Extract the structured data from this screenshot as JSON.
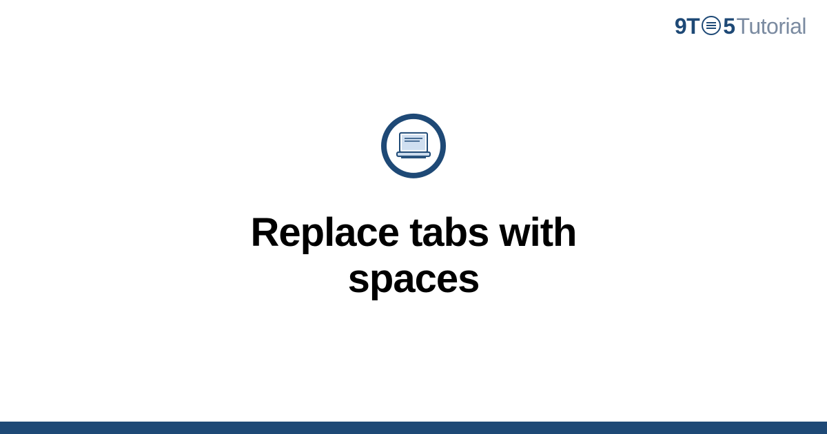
{
  "header": {
    "logo": {
      "part1": "9T",
      "part2": "5",
      "suffix": "Tutorial"
    }
  },
  "main": {
    "title": "Replace tabs with spaces"
  },
  "colors": {
    "brand": "#1e4976",
    "muted": "#7a8aa0"
  }
}
